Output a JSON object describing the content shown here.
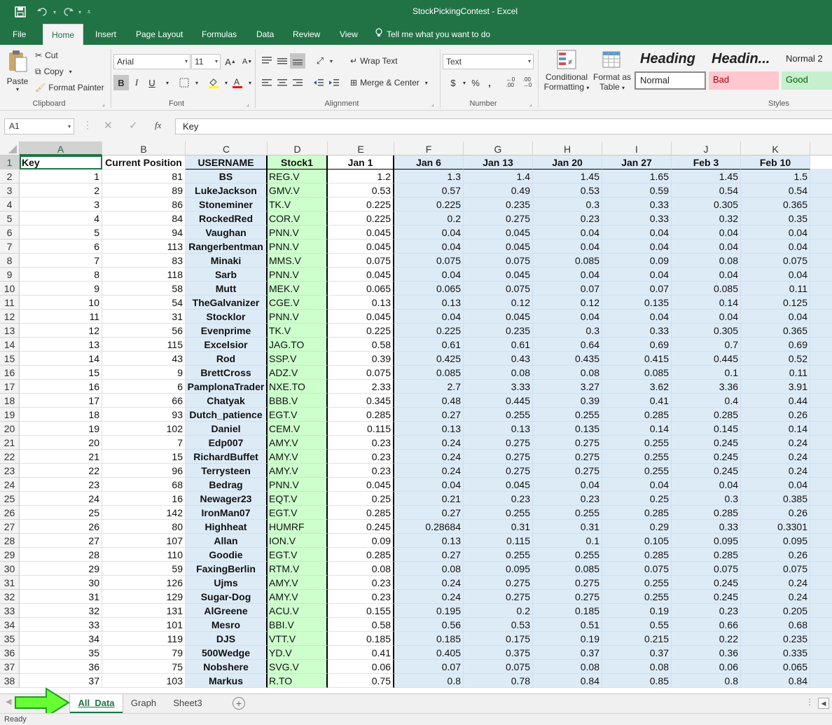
{
  "title": "StockPickingContest  -  Excel",
  "quick_access": {
    "save_icon": "save-icon",
    "undo_icon": "undo-icon",
    "redo_icon": "redo-icon",
    "customize_icon": "customize-qat-icon"
  },
  "ribbon_tabs": [
    "File",
    "Home",
    "Insert",
    "Page Layout",
    "Formulas",
    "Data",
    "Review",
    "View"
  ],
  "active_tab": "Home",
  "tell_me": "Tell me what you want to do",
  "clipboard": {
    "paste": "Paste",
    "cut": "Cut",
    "copy": "Copy",
    "format_painter": "Format Painter",
    "label": "Clipboard"
  },
  "font": {
    "name": "Arial",
    "size": "11",
    "bold": "B",
    "italic": "I",
    "underline": "U",
    "label": "Font"
  },
  "alignment": {
    "wrap_text": "Wrap Text",
    "merge_center": "Merge & Center",
    "label": "Alignment"
  },
  "number": {
    "format": "Text",
    "currency": "$",
    "percent": "%",
    "comma": ",",
    "label": "Number"
  },
  "styles": {
    "conditional_1": "Conditional",
    "conditional_2": "Formatting",
    "format_table_1": "Format as",
    "format_table_2": "Table",
    "heading1": "Heading",
    "heading2": "Headin...",
    "normal2": "Normal 2",
    "normal": "Normal",
    "bad": "Bad",
    "good": "Good",
    "label": "Styles"
  },
  "formula_bar": {
    "cell_ref": "A1",
    "content": "Key"
  },
  "columns": [
    "A",
    "B",
    "C",
    "D",
    "E",
    "F",
    "G",
    "H",
    "I",
    "J",
    "K"
  ],
  "headers": [
    "Key",
    "Current Position",
    "USERNAME",
    "Stock1",
    "Jan 1",
    "Jan 6",
    "Jan 13",
    "Jan 20",
    "Jan 27",
    "Feb 3",
    "Feb 10"
  ],
  "rows": [
    [
      "1",
      "81",
      "BS",
      "REG.V",
      "1.2",
      "1.3",
      "1.4",
      "1.45",
      "1.65",
      "1.45",
      "1.5"
    ],
    [
      "2",
      "89",
      "LukeJackson",
      "GMV.V",
      "0.53",
      "0.57",
      "0.49",
      "0.53",
      "0.59",
      "0.54",
      "0.54"
    ],
    [
      "3",
      "86",
      "Stoneminer",
      "TK.V",
      "0.225",
      "0.225",
      "0.235",
      "0.3",
      "0.33",
      "0.305",
      "0.365"
    ],
    [
      "4",
      "84",
      "RockedRed",
      "COR.V",
      "0.225",
      "0.2",
      "0.275",
      "0.23",
      "0.33",
      "0.32",
      "0.35"
    ],
    [
      "5",
      "94",
      "Vaughan",
      "PNN.V",
      "0.045",
      "0.04",
      "0.045",
      "0.04",
      "0.04",
      "0.04",
      "0.04"
    ],
    [
      "6",
      "113",
      "Rangerbentman",
      "PNN.V",
      "0.045",
      "0.04",
      "0.045",
      "0.04",
      "0.04",
      "0.04",
      "0.04"
    ],
    [
      "7",
      "83",
      "Minaki",
      "MMS.V",
      "0.075",
      "0.075",
      "0.075",
      "0.085",
      "0.09",
      "0.08",
      "0.075"
    ],
    [
      "8",
      "118",
      "Sarb",
      "PNN.V",
      "0.045",
      "0.04",
      "0.045",
      "0.04",
      "0.04",
      "0.04",
      "0.04"
    ],
    [
      "9",
      "58",
      "Mutt",
      "MEK.V",
      "0.065",
      "0.065",
      "0.075",
      "0.07",
      "0.07",
      "0.085",
      "0.11"
    ],
    [
      "10",
      "54",
      "TheGalvanizer",
      "CGE.V",
      "0.13",
      "0.13",
      "0.12",
      "0.12",
      "0.135",
      "0.14",
      "0.125"
    ],
    [
      "11",
      "31",
      "Stocklor",
      "PNN.V",
      "0.045",
      "0.04",
      "0.045",
      "0.04",
      "0.04",
      "0.04",
      "0.04"
    ],
    [
      "12",
      "56",
      "Evenprime",
      "TK.V",
      "0.225",
      "0.225",
      "0.235",
      "0.3",
      "0.33",
      "0.305",
      "0.365"
    ],
    [
      "13",
      "115",
      "Excelsior",
      "JAG.TO",
      "0.58",
      "0.61",
      "0.61",
      "0.64",
      "0.69",
      "0.7",
      "0.69"
    ],
    [
      "14",
      "43",
      "Rod",
      "SSP.V",
      "0.39",
      "0.425",
      "0.43",
      "0.435",
      "0.415",
      "0.445",
      "0.52"
    ],
    [
      "15",
      "9",
      "BrettCross",
      "ADZ.V",
      "0.075",
      "0.085",
      "0.08",
      "0.08",
      "0.085",
      "0.1",
      "0.11"
    ],
    [
      "16",
      "6",
      "PamplonaTrader",
      "NXE.TO",
      "2.33",
      "2.7",
      "3.33",
      "3.27",
      "3.62",
      "3.36",
      "3.91"
    ],
    [
      "17",
      "66",
      "Chatyak",
      "BBB.V",
      "0.345",
      "0.48",
      "0.445",
      "0.39",
      "0.41",
      "0.4",
      "0.44"
    ],
    [
      "18",
      "93",
      "Dutch_patience",
      "EGT.V",
      "0.285",
      "0.27",
      "0.255",
      "0.255",
      "0.285",
      "0.285",
      "0.26"
    ],
    [
      "19",
      "102",
      "Daniel",
      "CEM.V",
      "0.115",
      "0.13",
      "0.13",
      "0.135",
      "0.14",
      "0.145",
      "0.14"
    ],
    [
      "20",
      "7",
      "Edp007",
      "AMY.V",
      "0.23",
      "0.24",
      "0.275",
      "0.275",
      "0.255",
      "0.245",
      "0.24"
    ],
    [
      "21",
      "15",
      "RichardBuffet",
      "AMY.V",
      "0.23",
      "0.24",
      "0.275",
      "0.275",
      "0.255",
      "0.245",
      "0.24"
    ],
    [
      "22",
      "96",
      "Terrysteen",
      "AMY.V",
      "0.23",
      "0.24",
      "0.275",
      "0.275",
      "0.255",
      "0.245",
      "0.24"
    ],
    [
      "23",
      "68",
      "Bedrag",
      "PNN.V",
      "0.045",
      "0.04",
      "0.045",
      "0.04",
      "0.04",
      "0.04",
      "0.04"
    ],
    [
      "24",
      "16",
      "Newager23",
      "EQT.V",
      "0.25",
      "0.21",
      "0.23",
      "0.23",
      "0.25",
      "0.3",
      "0.385"
    ],
    [
      "25",
      "142",
      "IronMan07",
      "EGT.V",
      "0.285",
      "0.27",
      "0.255",
      "0.255",
      "0.285",
      "0.285",
      "0.26"
    ],
    [
      "26",
      "80",
      "Highheat",
      "HUMRF",
      "0.245",
      "0.28684",
      "0.31",
      "0.31",
      "0.29",
      "0.33",
      "0.3301"
    ],
    [
      "27",
      "107",
      "Allan",
      "ION.V",
      "0.09",
      "0.13",
      "0.115",
      "0.1",
      "0.105",
      "0.095",
      "0.095"
    ],
    [
      "28",
      "110",
      "Goodie",
      "EGT.V",
      "0.285",
      "0.27",
      "0.255",
      "0.255",
      "0.285",
      "0.285",
      "0.26"
    ],
    [
      "29",
      "59",
      "FaxingBerlin",
      "RTM.V",
      "0.08",
      "0.08",
      "0.095",
      "0.085",
      "0.075",
      "0.075",
      "0.075"
    ],
    [
      "30",
      "126",
      "Ujms",
      "AMY.V",
      "0.23",
      "0.24",
      "0.275",
      "0.275",
      "0.255",
      "0.245",
      "0.24"
    ],
    [
      "31",
      "129",
      "Sugar-Dog",
      "AMY.V",
      "0.23",
      "0.24",
      "0.275",
      "0.275",
      "0.255",
      "0.245",
      "0.24"
    ],
    [
      "32",
      "131",
      "AlGreene",
      "ACU.V",
      "0.155",
      "0.195",
      "0.2",
      "0.185",
      "0.19",
      "0.23",
      "0.205"
    ],
    [
      "33",
      "101",
      "Mesro",
      "BBI.V",
      "0.58",
      "0.56",
      "0.53",
      "0.51",
      "0.55",
      "0.66",
      "0.68"
    ],
    [
      "34",
      "119",
      "DJS",
      "VTT.V",
      "0.185",
      "0.185",
      "0.175",
      "0.19",
      "0.215",
      "0.22",
      "0.235"
    ],
    [
      "35",
      "79",
      "500Wedge",
      "YD.V",
      "0.41",
      "0.405",
      "0.375",
      "0.37",
      "0.37",
      "0.36",
      "0.335"
    ],
    [
      "36",
      "75",
      "Nobshere",
      "SVG.V",
      "0.06",
      "0.07",
      "0.075",
      "0.08",
      "0.08",
      "0.06",
      "0.065"
    ],
    [
      "37",
      "103",
      "Markus",
      "R.TO",
      "0.75",
      "0.8",
      "0.78",
      "0.84",
      "0.85",
      "0.8",
      "0.84"
    ]
  ],
  "sheet_tabs": [
    "All_Data",
    "Graph",
    "Sheet3"
  ],
  "active_sheet": "All_Data",
  "status": "Ready",
  "colors": {
    "excel_green": "#217346",
    "blue_fill": "#ddebf7",
    "green_fill": "#ccffcc",
    "arrow": "#66ff33"
  }
}
